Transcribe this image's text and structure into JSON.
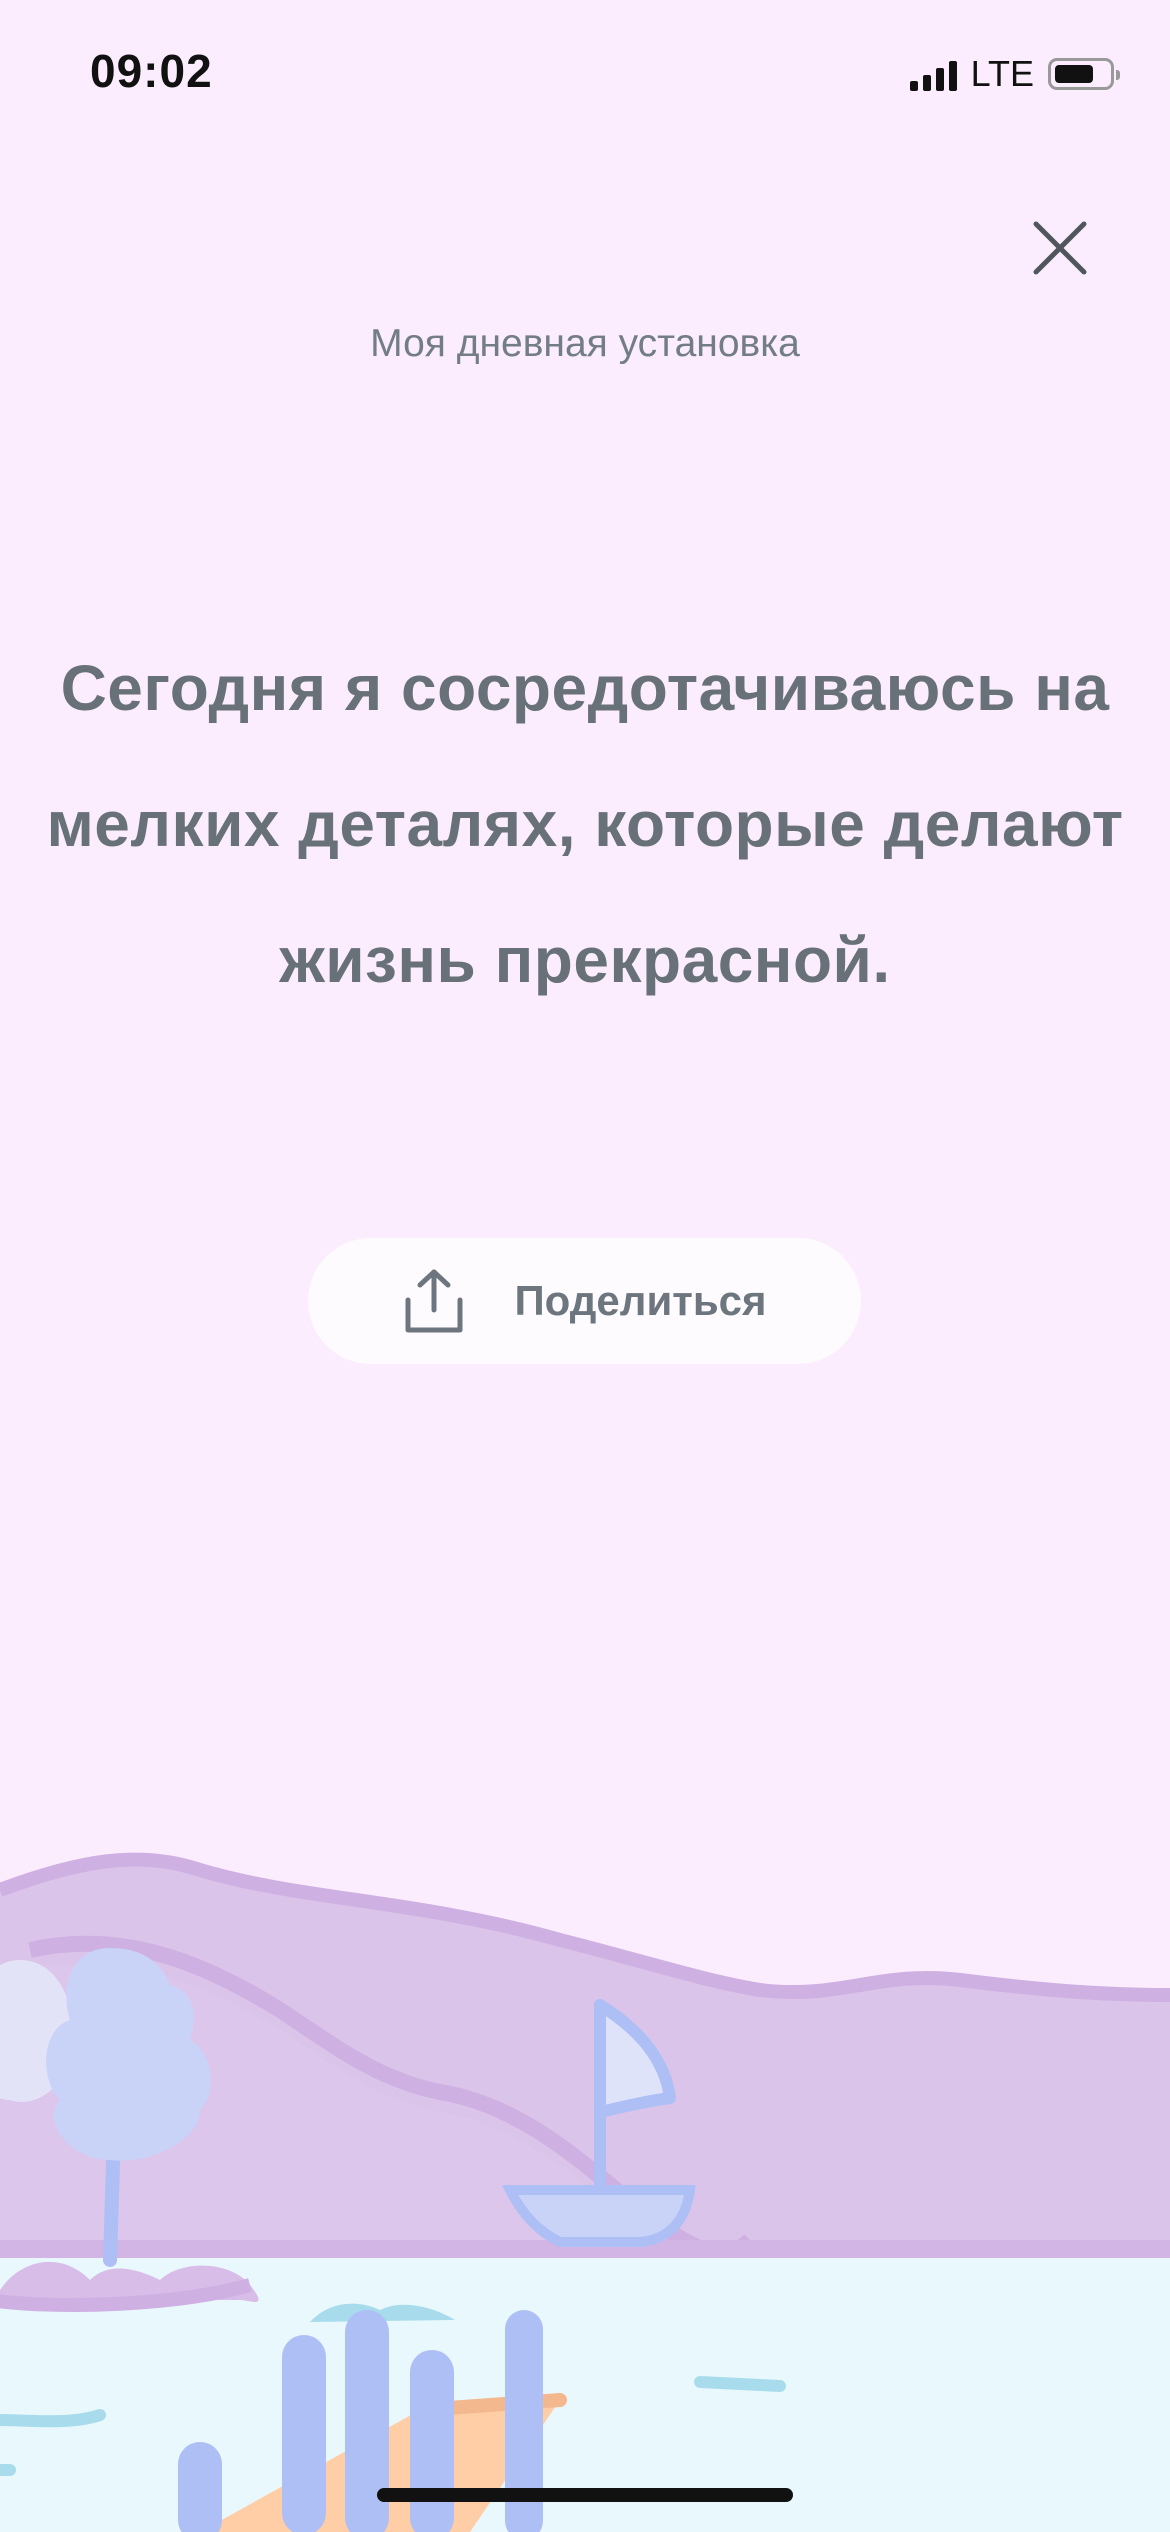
{
  "status_bar": {
    "time": "09:02",
    "network": "LTE"
  },
  "header": {
    "subtitle": "Моя дневная установка"
  },
  "affirmation": {
    "text": "Сегодня я сосредотачиваюсь на мелких деталях, которые делают жизнь прекрасной."
  },
  "actions": {
    "share_label": "Поделиться"
  },
  "icons": {
    "close": "close-icon",
    "share": "share-icon"
  },
  "colors": {
    "background": "#fbedfd",
    "text": "#687178",
    "button_bg": "#fefbfe",
    "water": "#e9f8fc",
    "hills": "#dac4e9"
  }
}
